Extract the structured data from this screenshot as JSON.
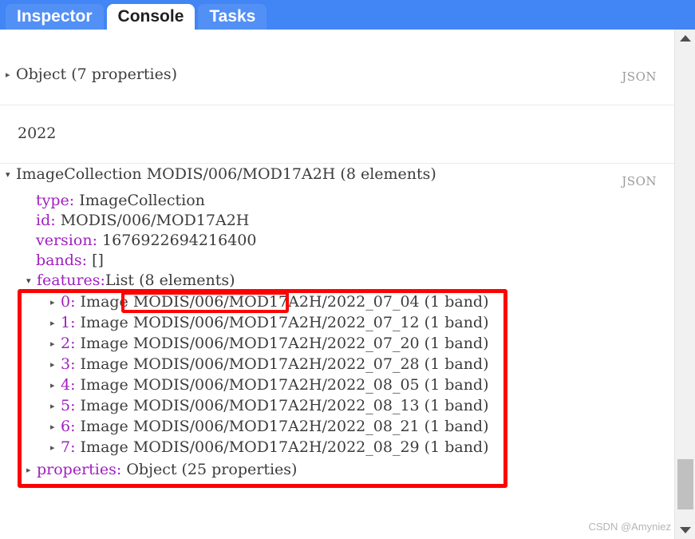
{
  "tabs": [
    {
      "label": "Inspector",
      "active": false
    },
    {
      "label": "Console",
      "active": true
    },
    {
      "label": "Tasks",
      "active": false
    }
  ],
  "json_label": "JSON",
  "sections": {
    "object_summary": {
      "toggle": "▸",
      "text": "Object (7 properties)"
    },
    "year_entry": {
      "text": "2022"
    },
    "collection": {
      "toggle": "▾",
      "header": "ImageCollection MODIS/006/MOD17A2H (8 elements)",
      "properties": [
        {
          "key": "type:",
          "value": "ImageCollection"
        },
        {
          "key": "id:",
          "value": "MODIS/006/MOD17A2H"
        },
        {
          "key": "version:",
          "value": "1676922694216400"
        },
        {
          "key": "bands:",
          "value": "[]"
        }
      ],
      "features": {
        "toggle": "▾",
        "key": "features:",
        "value": "List (8 elements)",
        "items": [
          {
            "toggle": "▸",
            "index": "0:",
            "text": "Image MODIS/006/MOD17A2H/2022_07_04  (1 band)"
          },
          {
            "toggle": "▸",
            "index": "1:",
            "text": "Image MODIS/006/MOD17A2H/2022_07_12  (1 band)"
          },
          {
            "toggle": "▸",
            "index": "2:",
            "text": "Image MODIS/006/MOD17A2H/2022_07_20  (1 band)"
          },
          {
            "toggle": "▸",
            "index": "3:",
            "text": "Image MODIS/006/MOD17A2H/2022_07_28  (1 band)"
          },
          {
            "toggle": "▸",
            "index": "4:",
            "text": "Image MODIS/006/MOD17A2H/2022_08_05  (1 band)"
          },
          {
            "toggle": "▸",
            "index": "5:",
            "text": "Image MODIS/006/MOD17A2H/2022_08_13  (1 band)"
          },
          {
            "toggle": "▸",
            "index": "6:",
            "text": "Image MODIS/006/MOD17A2H/2022_08_21  (1 band)"
          },
          {
            "toggle": "▸",
            "index": "7:",
            "text": "Image MODIS/006/MOD17A2H/2022_08_29  (1 band)"
          }
        ]
      },
      "properties_entry": {
        "toggle": "▸",
        "key": "properties:",
        "value": "Object (25 properties)"
      }
    }
  },
  "annotations": {
    "color": "#fe0000",
    "outer_box_target": "features-list-block",
    "inner_box_target": "features-list-value"
  },
  "scrollbar": {
    "up_arrow": "scroll-up",
    "down_arrow": "scroll-down"
  },
  "watermark": "CSDN @Amyniez"
}
